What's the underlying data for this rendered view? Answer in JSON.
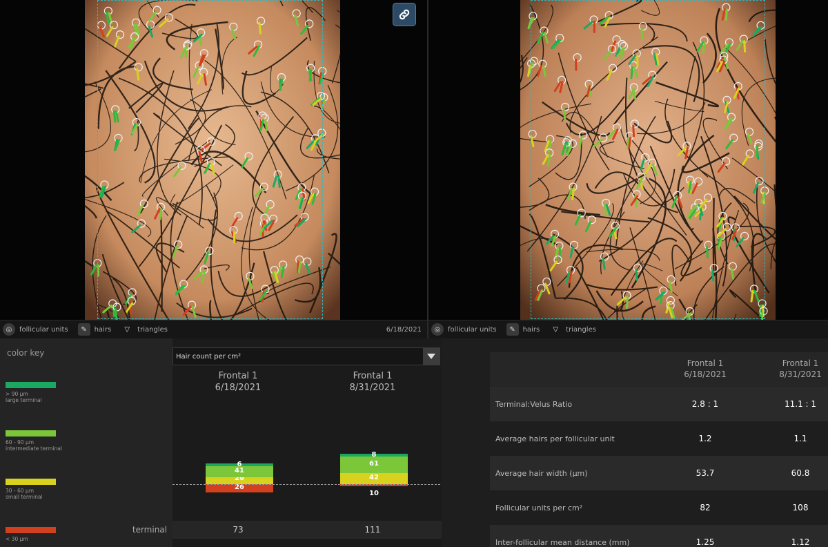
{
  "link_icon": "chain-link-icon",
  "left_view": {
    "toolbar": [
      {
        "label": "follicular units",
        "icon": "target-icon"
      },
      {
        "label": "hairs",
        "icon": "hair-icon"
      },
      {
        "label": "triangles",
        "icon": "triangle-icon"
      }
    ],
    "date": "6/18/2021"
  },
  "right_view": {
    "toolbar": [
      {
        "label": "follicular units",
        "icon": "target-icon"
      },
      {
        "label": "hairs",
        "icon": "hair-icon"
      },
      {
        "label": "triangles",
        "icon": "triangle-icon"
      }
    ],
    "date": ""
  },
  "color_key": {
    "title": "color key",
    "items": [
      {
        "line1": "> 90 µm",
        "line2": "large terminal",
        "color": "#1aa862"
      },
      {
        "line1": "60 - 90 µm",
        "line2": "intermediate terminal",
        "color": "#7cc63a"
      },
      {
        "line1": "30 - 60 µm",
        "line2": "small terminal",
        "color": "#d8d21e"
      },
      {
        "line1": "< 30 µm",
        "line2": "",
        "color": "#d2401e"
      }
    ]
  },
  "chart": {
    "dropdown_value": "Hair count per cm²",
    "columns": [
      {
        "title": "Frontal 1",
        "date": "6/18/2021"
      },
      {
        "title": "Frontal 1",
        "date": "8/31/2021"
      }
    ],
    "rows": [
      {
        "label": "terminal",
        "values": [
          "73",
          "111"
        ]
      }
    ]
  },
  "chart_data": {
    "type": "bar",
    "stacked": true,
    "categories": [
      "6/18/2021",
      "8/31/2021"
    ],
    "series": [
      {
        "name": "> 90 µm",
        "color": "#1aa862",
        "values": [
          6,
          8
        ]
      },
      {
        "name": "60 - 90 µm",
        "color": "#7cc63a",
        "values": [
          41,
          61
        ]
      },
      {
        "name": "30 - 60 µm",
        "color": "#d8d21e",
        "values": [
          26,
          42
        ]
      },
      {
        "name": "< 30 µm",
        "color": "#d2401e",
        "values": [
          26,
          10
        ]
      }
    ],
    "title": "",
    "xlabel": "",
    "ylabel": "Hair count per cm²"
  },
  "stats": {
    "columns": [
      {
        "title": "Frontal 1",
        "date": "6/18/2021"
      },
      {
        "title": "Frontal 1",
        "date": "8/31/2021"
      }
    ],
    "rows": [
      {
        "label": "Terminal:Velus Ratio",
        "values": [
          "2.8 : 1",
          "11.1 : 1"
        ]
      },
      {
        "label": "Average hairs per follicular unit",
        "values": [
          "1.2",
          "1.1"
        ]
      },
      {
        "label": "Average hair width (µm)",
        "values": [
          "53.7",
          "60.8"
        ]
      },
      {
        "label": "Follicular units per cm²",
        "values": [
          "82",
          "108"
        ]
      },
      {
        "label": "Inter-follicular mean distance (mm)",
        "values": [
          "1.25",
          "1.12"
        ]
      }
    ]
  },
  "colors": {
    "accent": "#2fb7c0",
    "link_button": "#2c4a66"
  }
}
